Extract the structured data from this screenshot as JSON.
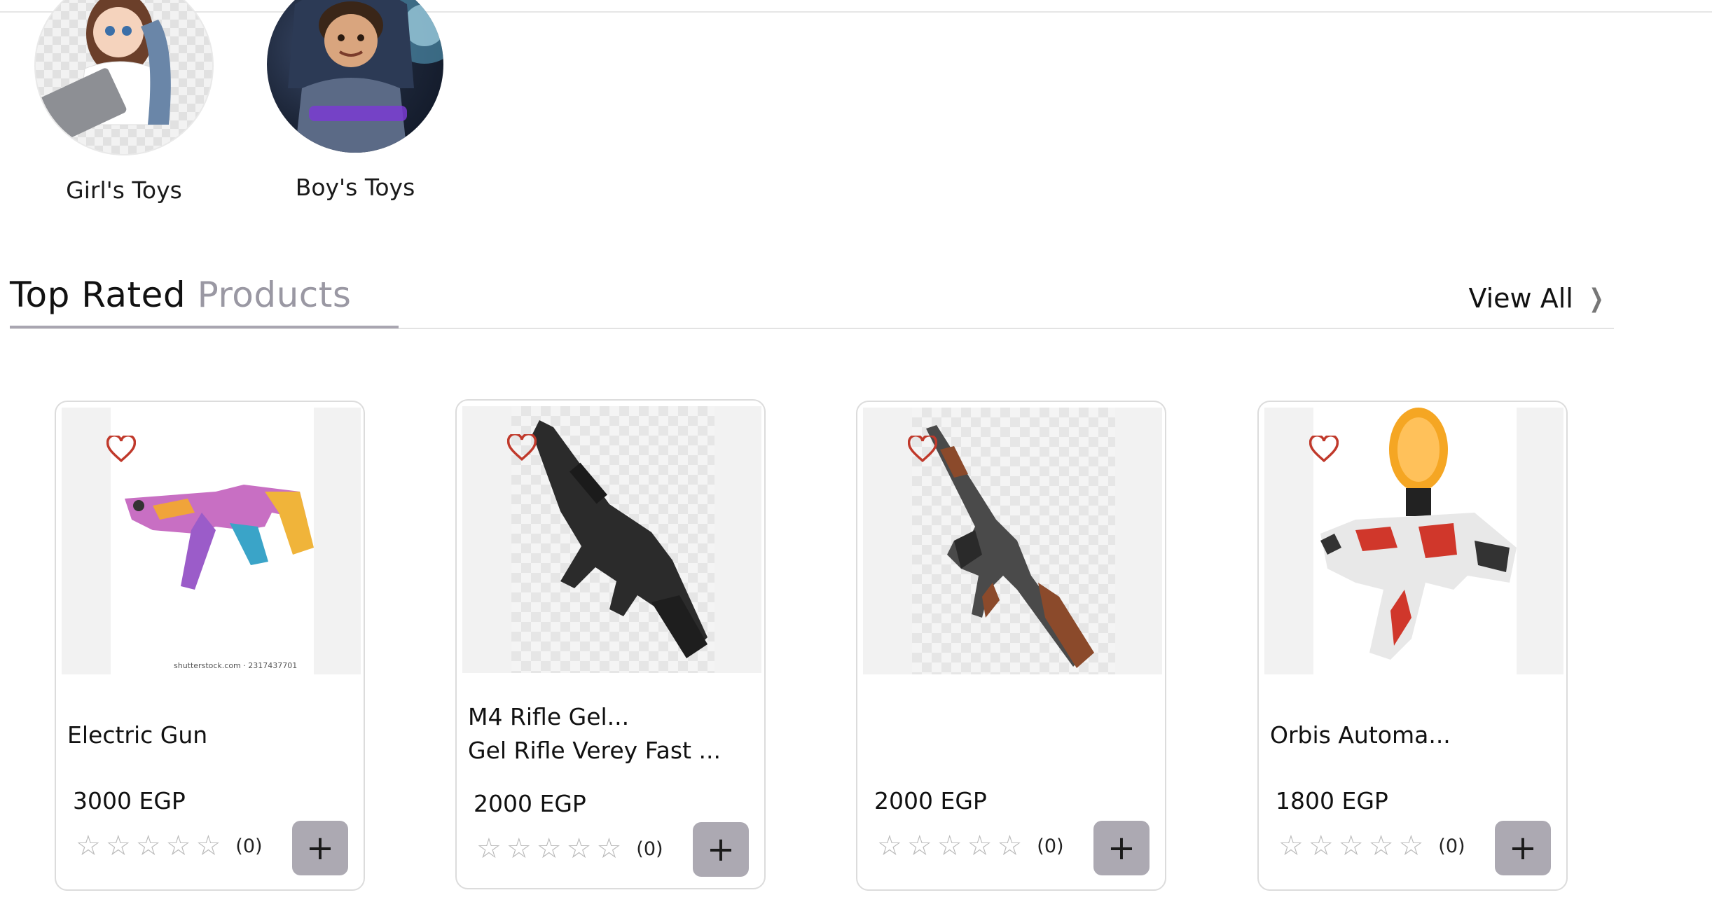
{
  "categories": [
    {
      "label": "Girl's Toys"
    },
    {
      "label": "Boy's Toys"
    }
  ],
  "section": {
    "title_main": "Top Rated",
    "title_accent": "Products",
    "view_all": "View All"
  },
  "products": [
    {
      "name_line1": "Electric Gun",
      "name_line2": "",
      "price": "3000 EGP",
      "rating_count": "(0)",
      "stars": 0,
      "watermark": "shutterstock.com · 2317437701"
    },
    {
      "name_line1": "M4 Rifle Gel...",
      "name_line2": "Gel Rifle Verey Fast ...",
      "price": "2000 EGP",
      "rating_count": "(0)",
      "stars": 0
    },
    {
      "name_line1": "",
      "name_line2": "",
      "price": "2000 EGP",
      "rating_count": "(0)",
      "stars": 0
    },
    {
      "name_line1": "Orbis Automa...",
      "name_line2": "",
      "price": "1800 EGP",
      "rating_count": "(0)",
      "stars": 0
    }
  ],
  "icons": {
    "favorite": "heart-outline-icon",
    "add": "plus-icon",
    "star": "star-outline-icon",
    "view_all": "chevron-right-icon"
  },
  "colors": {
    "heart": "#c0392b",
    "accent_text": "#9a98a3",
    "add_button": "#aca9b2",
    "star": "#b9b9b9"
  }
}
